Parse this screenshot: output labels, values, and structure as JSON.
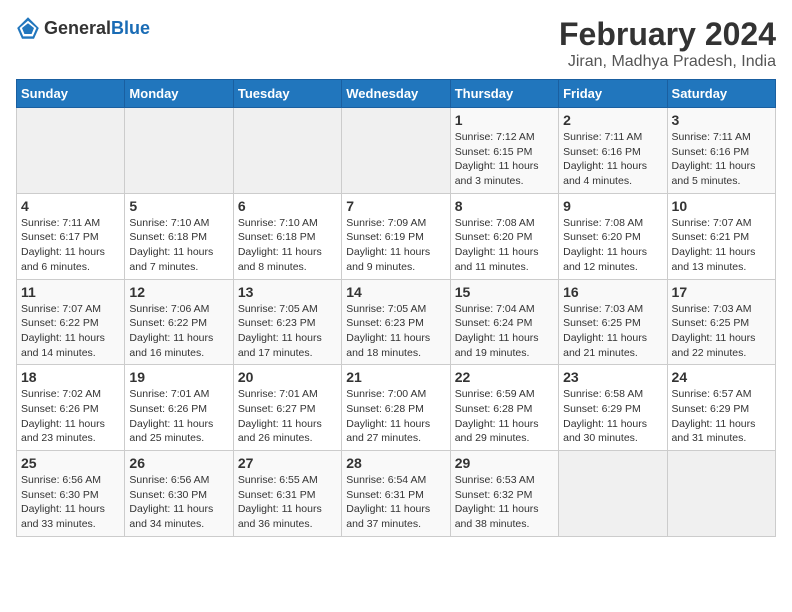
{
  "header": {
    "logo_general": "General",
    "logo_blue": "Blue",
    "title": "February 2024",
    "subtitle": "Jiran, Madhya Pradesh, India"
  },
  "calendar": {
    "days_of_week": [
      "Sunday",
      "Monday",
      "Tuesday",
      "Wednesday",
      "Thursday",
      "Friday",
      "Saturday"
    ],
    "weeks": [
      [
        {
          "day": "",
          "info": ""
        },
        {
          "day": "",
          "info": ""
        },
        {
          "day": "",
          "info": ""
        },
        {
          "day": "",
          "info": ""
        },
        {
          "day": "1",
          "info": "Sunrise: 7:12 AM\nSunset: 6:15 PM\nDaylight: 11 hours\nand 3 minutes."
        },
        {
          "day": "2",
          "info": "Sunrise: 7:11 AM\nSunset: 6:16 PM\nDaylight: 11 hours\nand 4 minutes."
        },
        {
          "day": "3",
          "info": "Sunrise: 7:11 AM\nSunset: 6:16 PM\nDaylight: 11 hours\nand 5 minutes."
        }
      ],
      [
        {
          "day": "4",
          "info": "Sunrise: 7:11 AM\nSunset: 6:17 PM\nDaylight: 11 hours\nand 6 minutes."
        },
        {
          "day": "5",
          "info": "Sunrise: 7:10 AM\nSunset: 6:18 PM\nDaylight: 11 hours\nand 7 minutes."
        },
        {
          "day": "6",
          "info": "Sunrise: 7:10 AM\nSunset: 6:18 PM\nDaylight: 11 hours\nand 8 minutes."
        },
        {
          "day": "7",
          "info": "Sunrise: 7:09 AM\nSunset: 6:19 PM\nDaylight: 11 hours\nand 9 minutes."
        },
        {
          "day": "8",
          "info": "Sunrise: 7:08 AM\nSunset: 6:20 PM\nDaylight: 11 hours\nand 11 minutes."
        },
        {
          "day": "9",
          "info": "Sunrise: 7:08 AM\nSunset: 6:20 PM\nDaylight: 11 hours\nand 12 minutes."
        },
        {
          "day": "10",
          "info": "Sunrise: 7:07 AM\nSunset: 6:21 PM\nDaylight: 11 hours\nand 13 minutes."
        }
      ],
      [
        {
          "day": "11",
          "info": "Sunrise: 7:07 AM\nSunset: 6:22 PM\nDaylight: 11 hours\nand 14 minutes."
        },
        {
          "day": "12",
          "info": "Sunrise: 7:06 AM\nSunset: 6:22 PM\nDaylight: 11 hours\nand 16 minutes."
        },
        {
          "day": "13",
          "info": "Sunrise: 7:05 AM\nSunset: 6:23 PM\nDaylight: 11 hours\nand 17 minutes."
        },
        {
          "day": "14",
          "info": "Sunrise: 7:05 AM\nSunset: 6:23 PM\nDaylight: 11 hours\nand 18 minutes."
        },
        {
          "day": "15",
          "info": "Sunrise: 7:04 AM\nSunset: 6:24 PM\nDaylight: 11 hours\nand 19 minutes."
        },
        {
          "day": "16",
          "info": "Sunrise: 7:03 AM\nSunset: 6:25 PM\nDaylight: 11 hours\nand 21 minutes."
        },
        {
          "day": "17",
          "info": "Sunrise: 7:03 AM\nSunset: 6:25 PM\nDaylight: 11 hours\nand 22 minutes."
        }
      ],
      [
        {
          "day": "18",
          "info": "Sunrise: 7:02 AM\nSunset: 6:26 PM\nDaylight: 11 hours\nand 23 minutes."
        },
        {
          "day": "19",
          "info": "Sunrise: 7:01 AM\nSunset: 6:26 PM\nDaylight: 11 hours\nand 25 minutes."
        },
        {
          "day": "20",
          "info": "Sunrise: 7:01 AM\nSunset: 6:27 PM\nDaylight: 11 hours\nand 26 minutes."
        },
        {
          "day": "21",
          "info": "Sunrise: 7:00 AM\nSunset: 6:28 PM\nDaylight: 11 hours\nand 27 minutes."
        },
        {
          "day": "22",
          "info": "Sunrise: 6:59 AM\nSunset: 6:28 PM\nDaylight: 11 hours\nand 29 minutes."
        },
        {
          "day": "23",
          "info": "Sunrise: 6:58 AM\nSunset: 6:29 PM\nDaylight: 11 hours\nand 30 minutes."
        },
        {
          "day": "24",
          "info": "Sunrise: 6:57 AM\nSunset: 6:29 PM\nDaylight: 11 hours\nand 31 minutes."
        }
      ],
      [
        {
          "day": "25",
          "info": "Sunrise: 6:56 AM\nSunset: 6:30 PM\nDaylight: 11 hours\nand 33 minutes."
        },
        {
          "day": "26",
          "info": "Sunrise: 6:56 AM\nSunset: 6:30 PM\nDaylight: 11 hours\nand 34 minutes."
        },
        {
          "day": "27",
          "info": "Sunrise: 6:55 AM\nSunset: 6:31 PM\nDaylight: 11 hours\nand 36 minutes."
        },
        {
          "day": "28",
          "info": "Sunrise: 6:54 AM\nSunset: 6:31 PM\nDaylight: 11 hours\nand 37 minutes."
        },
        {
          "day": "29",
          "info": "Sunrise: 6:53 AM\nSunset: 6:32 PM\nDaylight: 11 hours\nand 38 minutes."
        },
        {
          "day": "",
          "info": ""
        },
        {
          "day": "",
          "info": ""
        }
      ]
    ]
  }
}
